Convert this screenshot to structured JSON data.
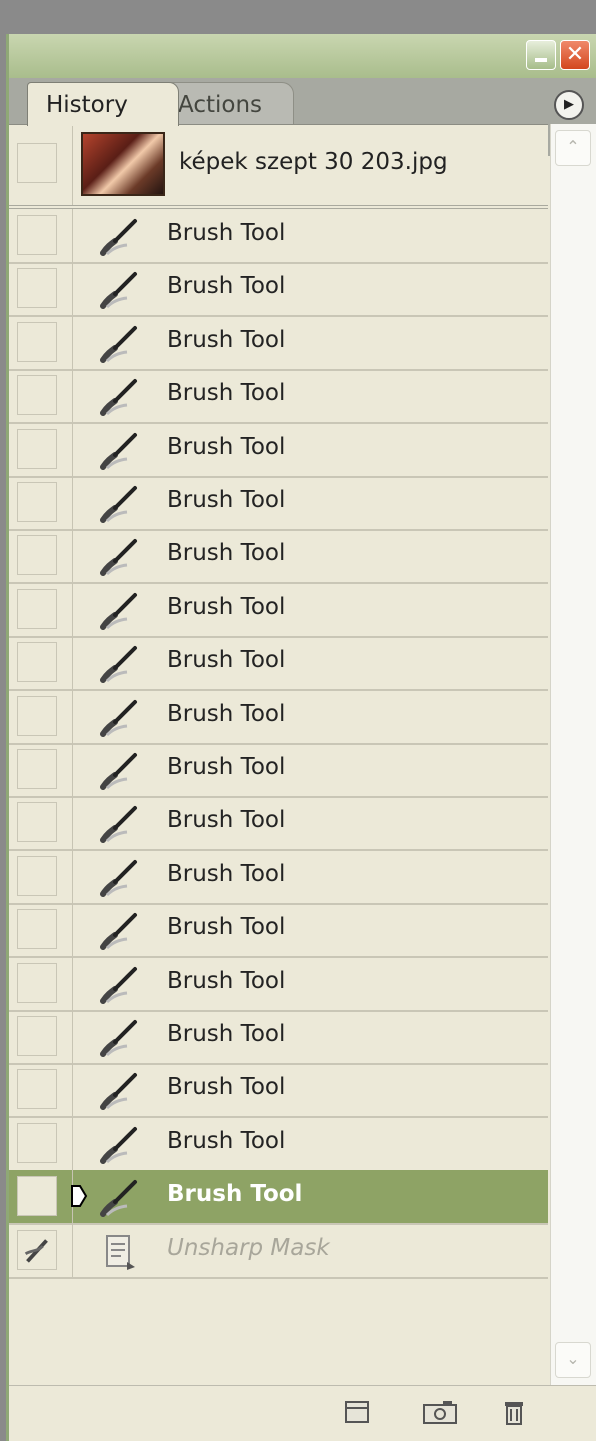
{
  "tabs": [
    {
      "label": "History",
      "active": true
    },
    {
      "label": "Actions",
      "active": false
    }
  ],
  "snapshot": {
    "label": "képek szept 30 203.jpg"
  },
  "history": [
    {
      "label": "Brush Tool",
      "state": "normal"
    },
    {
      "label": "Brush Tool",
      "state": "normal"
    },
    {
      "label": "Brush Tool",
      "state": "normal"
    },
    {
      "label": "Brush Tool",
      "state": "normal"
    },
    {
      "label": "Brush Tool",
      "state": "normal"
    },
    {
      "label": "Brush Tool",
      "state": "normal"
    },
    {
      "label": "Brush Tool",
      "state": "normal"
    },
    {
      "label": "Brush Tool",
      "state": "normal"
    },
    {
      "label": "Brush Tool",
      "state": "normal"
    },
    {
      "label": "Brush Tool",
      "state": "normal"
    },
    {
      "label": "Brush Tool",
      "state": "normal"
    },
    {
      "label": "Brush Tool",
      "state": "normal"
    },
    {
      "label": "Brush Tool",
      "state": "normal"
    },
    {
      "label": "Brush Tool",
      "state": "normal"
    },
    {
      "label": "Brush Tool",
      "state": "normal"
    },
    {
      "label": "Brush Tool",
      "state": "normal"
    },
    {
      "label": "Brush Tool",
      "state": "normal"
    },
    {
      "label": "Brush Tool",
      "state": "normal"
    },
    {
      "label": "Brush Tool",
      "state": "active"
    },
    {
      "label": "Unsharp Mask",
      "state": "dimmed"
    }
  ],
  "colors": {
    "panel_bg": "#ece9d8",
    "active_row": "#8ea365",
    "titlebar": "#b5c79b",
    "close_button": "#d9552c"
  },
  "icons": {
    "row_icon": "brush-icon",
    "filter_icon": "document-icon",
    "footer": [
      "new-document-icon",
      "camera-icon",
      "trash-icon"
    ]
  }
}
